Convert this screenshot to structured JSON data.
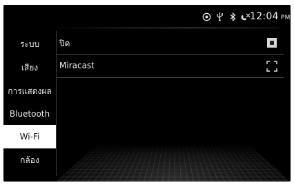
{
  "status": {
    "icons": [
      "navigation-circle-icon",
      "usb-icon",
      "bluetooth-icon",
      "phone-signal-off-icon"
    ],
    "time": "12:04",
    "ampm": "PM"
  },
  "sidebar": {
    "items": [
      {
        "label": "ระบบ",
        "selected": false
      },
      {
        "label": "เสียง",
        "selected": false
      },
      {
        "label": "การแสดงผล",
        "selected": false
      },
      {
        "label": "Bluetooth",
        "selected": false
      },
      {
        "label": "Wi-Fi",
        "selected": true
      },
      {
        "label": "กล้อง",
        "selected": false
      }
    ]
  },
  "main": {
    "rows": [
      {
        "label": "ปิด",
        "control": "radio-selected-icon"
      },
      {
        "label": "Miracast",
        "control": "expand-screen-icon"
      }
    ]
  },
  "colors": {
    "background": "#000000",
    "text": "#f2f2f2",
    "selected_bg": "#ffffff",
    "selected_text": "#111111",
    "divider": "#4a4a4a"
  }
}
